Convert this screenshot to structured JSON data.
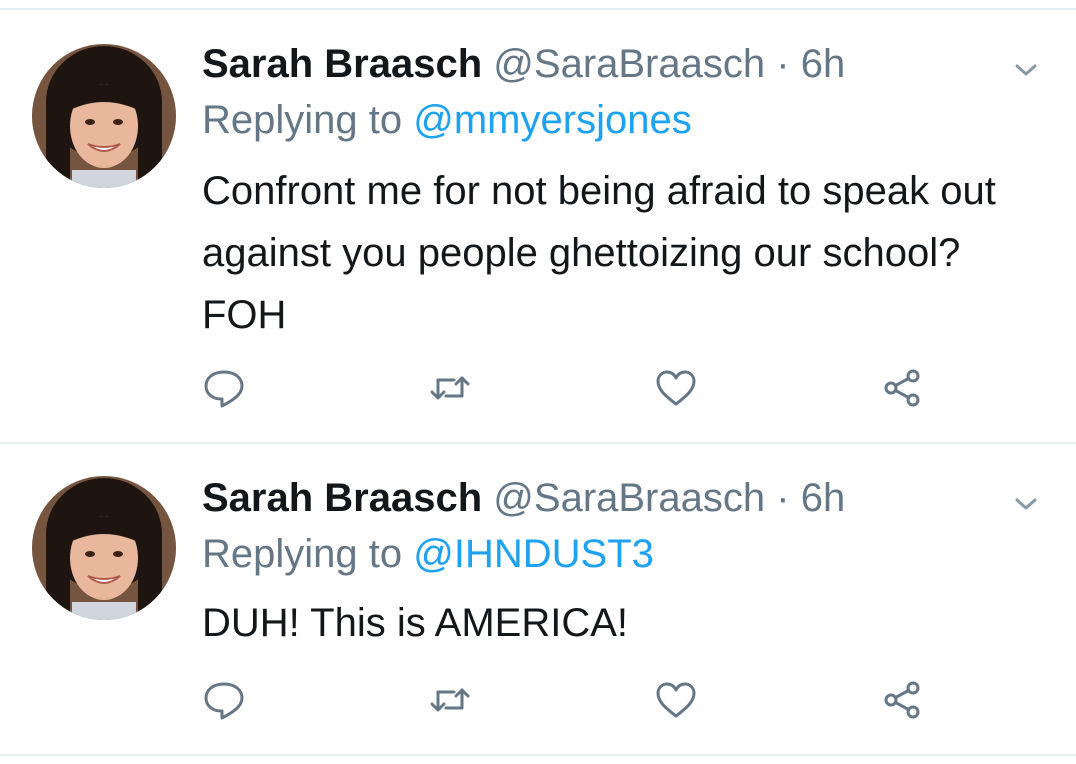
{
  "tweets": [
    {
      "display_name": "Sarah Braasch",
      "handle": "@SaraBraasch",
      "separator": "·",
      "time": "6h",
      "replying_prefix": "Replying to",
      "replying_to": "@mmyersjones",
      "text": "Confront me for not being afraid to speak out against you people ghettoizing our school? FOH",
      "icons": [
        "reply-icon",
        "retweet-icon",
        "like-icon",
        "share-icon"
      ]
    },
    {
      "display_name": "Sarah Braasch",
      "handle": "@SaraBraasch",
      "separator": "·",
      "time": "6h",
      "replying_prefix": "Replying to",
      "replying_to": "@IHNDUST3",
      "text": "DUH! This is AMERICA!",
      "icons": [
        "reply-icon",
        "retweet-icon",
        "like-icon",
        "share-icon"
      ]
    }
  ],
  "colors": {
    "text": "#14171a",
    "secondary": "#657786",
    "link": "#1da1f2",
    "divider": "#e6ecf0"
  }
}
